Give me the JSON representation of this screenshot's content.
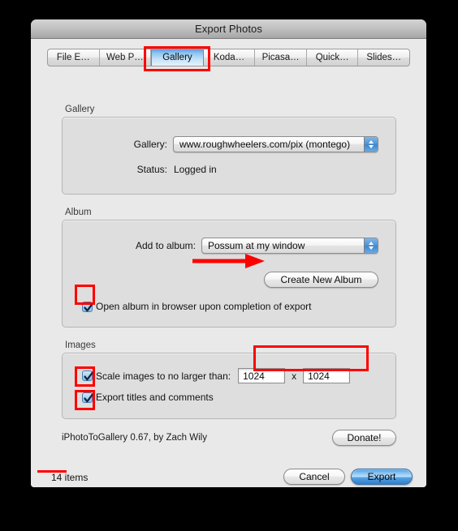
{
  "window": {
    "title": "Export Photos"
  },
  "tabs": [
    {
      "label": "File E…",
      "name": "tab-file-export",
      "active": false
    },
    {
      "label": "Web P…",
      "name": "tab-web-page",
      "active": false
    },
    {
      "label": "Gallery",
      "name": "tab-gallery",
      "active": true
    },
    {
      "label": "Koda…",
      "name": "tab-kodak",
      "active": false
    },
    {
      "label": "Picasa…",
      "name": "tab-picasa",
      "active": false
    },
    {
      "label": "Quick…",
      "name": "tab-quicktime",
      "active": false
    },
    {
      "label": "Slides…",
      "name": "tab-slideshow",
      "active": false
    }
  ],
  "gallery_section": {
    "title": "Gallery",
    "gallery_label": "Gallery:",
    "gallery_value": "www.roughwheelers.com/pix (montego)",
    "status_label": "Status:",
    "status_value": "Logged in"
  },
  "album_section": {
    "title": "Album",
    "add_to_album_label": "Add to album:",
    "add_to_album_value": "Possum at my window",
    "create_new_album_label": "Create New Album",
    "open_album_checkbox_label": "Open album in browser upon completion of export",
    "open_album_checked": true
  },
  "images_section": {
    "title": "Images",
    "scale_checkbox_label": "Scale images to no larger than:",
    "scale_checked": true,
    "width_value": "1024",
    "x_separator": "x",
    "height_value": "1024",
    "export_titles_checkbox_label": "Export titles and comments",
    "export_titles_checked": true
  },
  "footer": {
    "credit": "iPhotoToGallery 0.67, by Zach Wily",
    "donate_label": "Donate!"
  },
  "bottom_bar": {
    "item_count": "14 items",
    "cancel_label": "Cancel",
    "export_label": "Export"
  },
  "colors": {
    "annotation_red": "#ff0000",
    "accent_blue": "#4e94d8",
    "window_bg": "#e9e9e9",
    "group_bg": "#dedede",
    "titlebar_top": "#d4d4d4",
    "titlebar_bottom": "#a9a9a9"
  }
}
